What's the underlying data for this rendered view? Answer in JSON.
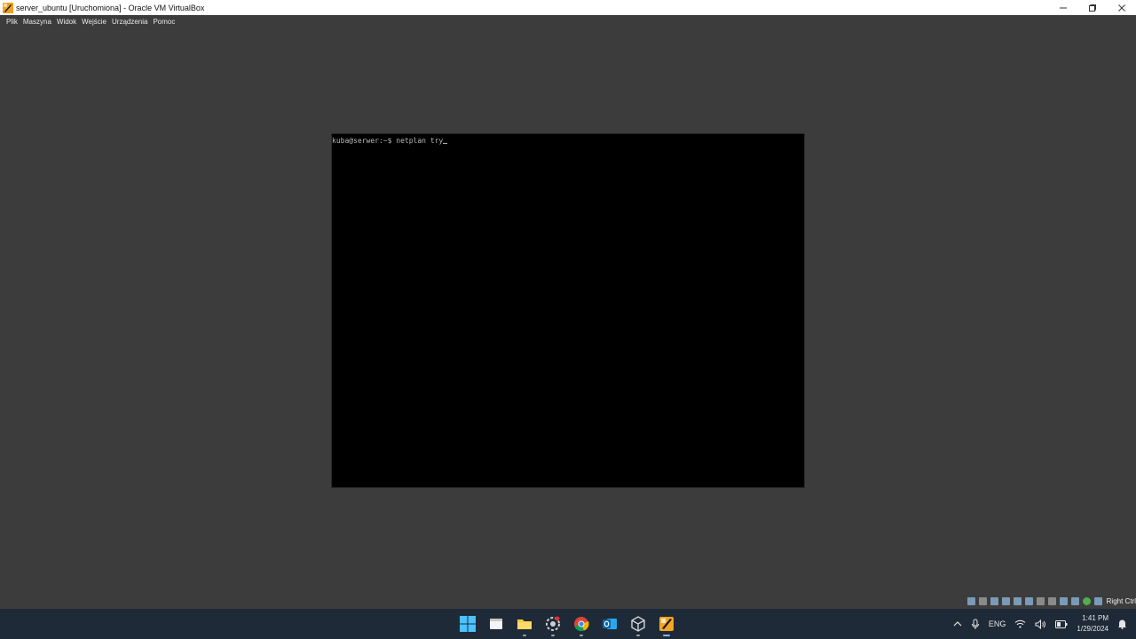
{
  "window": {
    "title": "server_ubuntu [Uruchomiona] - Oracle VM VirtualBox",
    "controls": [
      "minimize-icon",
      "restore-icon",
      "close-icon"
    ]
  },
  "menu": {
    "items": [
      "Plik",
      "Maszyna",
      "Widok",
      "Wejście",
      "Urządzenia",
      "Pomoc"
    ]
  },
  "terminal": {
    "prompt": "kuba@serwer:~$ ",
    "command": "netplan try"
  },
  "statusbar": {
    "icons": [
      "hard-disk-icon",
      "optical-drive-icon",
      "audio-icon",
      "network-icon",
      "usb-icon",
      "shared-folders-icon",
      "display-icon",
      "recording-icon",
      "cpu-icon",
      "capture-icon",
      "mouse-integration-icon",
      "keyboard-icon"
    ],
    "host_key": "Right Ctrl"
  },
  "taskbar": {
    "apps": [
      "start-icon",
      "task-view-icon",
      "file-explorer-icon",
      "settings-app-icon",
      "chrome-icon",
      "outlook-icon",
      "virtualbox-icon",
      "virtualbox-vm-icon"
    ],
    "tray": {
      "language": "ENG",
      "time": "1:41 PM",
      "date": "1/29/2024"
    }
  },
  "colors": {
    "background": "#3c3c3c",
    "taskbar": "#1f2a38",
    "terminal_bg": "#000000",
    "terminal_text": "#b8b8b8"
  }
}
